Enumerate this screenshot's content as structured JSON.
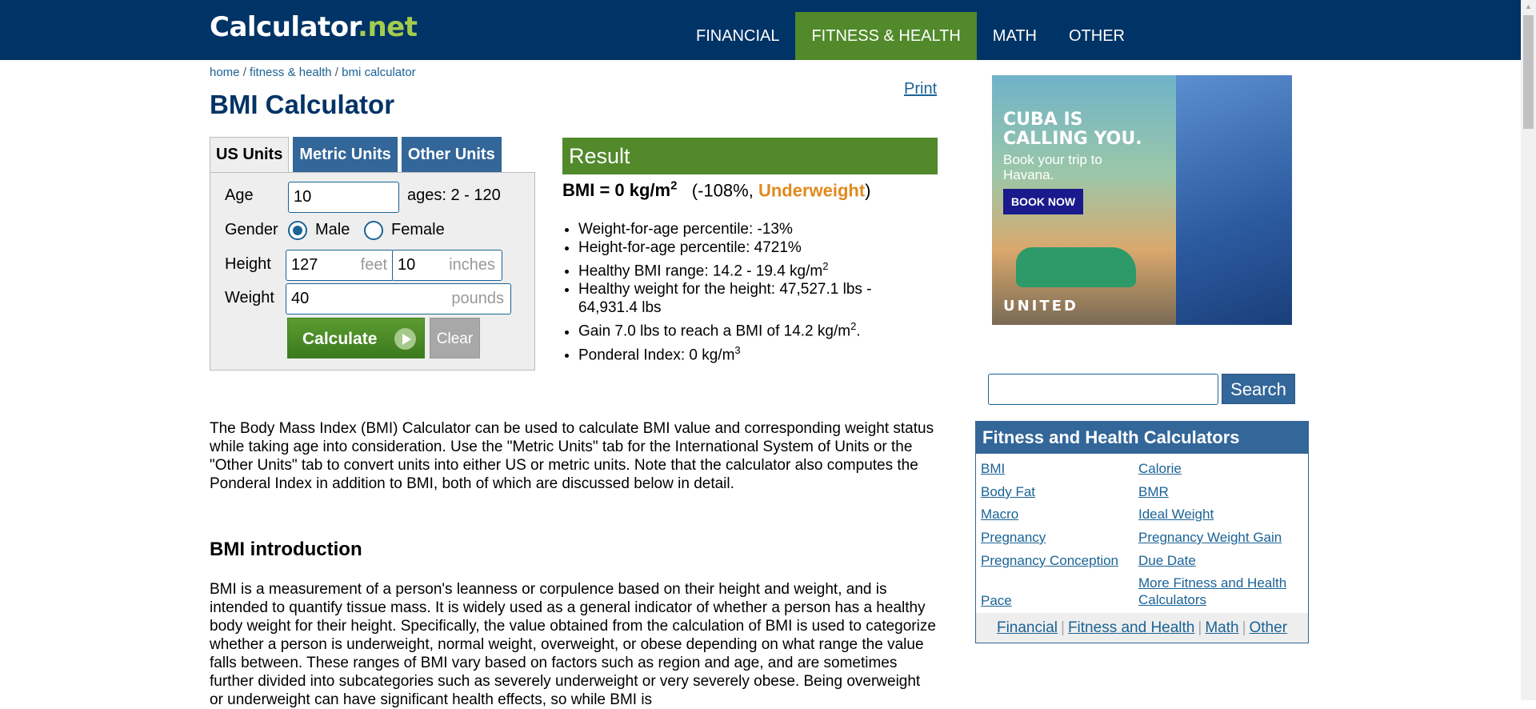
{
  "header": {
    "logo_main": "Calculator",
    "logo_dot": ".",
    "logo_net": "net",
    "nav": [
      "FINANCIAL",
      "FITNESS & HEALTH",
      "MATH",
      "OTHER"
    ]
  },
  "breadcrumb": [
    "home",
    "fitness & health",
    "bmi calculator"
  ],
  "breadcrumb_sep": " / ",
  "title": "BMI Calculator",
  "print_label": "Print",
  "tabs": [
    "US Units",
    "Metric Units",
    "Other Units"
  ],
  "form": {
    "age_label": "Age",
    "age_value": "10",
    "age_hint": "ages: 2 - 120",
    "gender_label": "Gender",
    "male_label": "Male",
    "female_label": "Female",
    "gender_selected": "Male",
    "height_label": "Height",
    "height_feet": "127",
    "feet_unit": "feet",
    "height_inches": "10",
    "inches_unit": "inches",
    "weight_label": "Weight",
    "weight_value": "40",
    "weight_unit": "pounds",
    "calculate_label": "Calculate",
    "clear_label": "Clear"
  },
  "result": {
    "header": "Result",
    "bmi_text": "BMI = 0 kg/m",
    "bmi_sup": "2",
    "pct_text": "(-108%, ",
    "status": "Underweight",
    "close_paren": ")",
    "items": [
      {
        "text": "Weight-for-age percentile: -13%",
        "sup": "",
        "after": ""
      },
      {
        "text": "Height-for-age percentile: 4721%",
        "sup": "",
        "after": ""
      },
      {
        "text": "Healthy BMI range: 14.2 - 19.4 kg/m",
        "sup": "2",
        "after": ""
      },
      {
        "text": "Healthy weight for the height: 47,527.1 lbs - 64,931.4 lbs",
        "sup": "",
        "after": ""
      },
      {
        "text": "Gain 7.0 lbs to reach a BMI of 14.2 kg/m",
        "sup": "2",
        "after": "."
      },
      {
        "text": "Ponderal Index: 0 kg/m",
        "sup": "3",
        "after": ""
      }
    ]
  },
  "content": {
    "intro_para": "The Body Mass Index (BMI) Calculator can be used to calculate BMI value and corresponding weight status while taking age into consideration. Use the \"Metric Units\" tab for the International System of Units or the \"Other Units\" tab to convert units into either US or metric units. Note that the calculator also computes the Ponderal Index in addition to BMI, both of which are discussed below in detail.",
    "section_heading": "BMI introduction",
    "section_para": "BMI is a measurement of a person's leanness or corpulence based on their height and weight, and is intended to quantify tissue mass. It is widely used as a general indicator of whether a person has a healthy body weight for their height. Specifically, the value obtained from the calculation of BMI is used to categorize whether a person is underweight, normal weight, overweight, or obese depending on what range the value falls between. These ranges of BMI vary based on factors such as region and age, and are sometimes further divided into subcategories such as severely underweight or very severely obese. Being overweight or underweight can have significant health effects, so while BMI is"
  },
  "ad": {
    "headline": "CUBA IS CALLING YOU.",
    "sub": "Book your trip to Havana.",
    "cta": "BOOK NOW",
    "brand": "UNITED"
  },
  "sidebar": {
    "search_value": "",
    "search_label": "Search",
    "box_title": "Fitness and Health Calculators",
    "links_left": [
      "BMI",
      "Body Fat",
      "Macro",
      "Pregnancy",
      "Pregnancy Conception",
      "Pace"
    ],
    "links_right": [
      "Calorie",
      "BMR",
      "Ideal Weight",
      "Pregnancy Weight Gain",
      "Due Date",
      "More Fitness and Health Calculators"
    ],
    "footer_links": [
      "Financial",
      "Fitness and Health",
      "Math",
      "Other"
    ]
  },
  "colors": {
    "nav_bg": "#003366",
    "accent_green": "#51892b",
    "link_blue": "#1b6396",
    "tab_blue": "#336699",
    "status_orange": "#e08a1e"
  }
}
